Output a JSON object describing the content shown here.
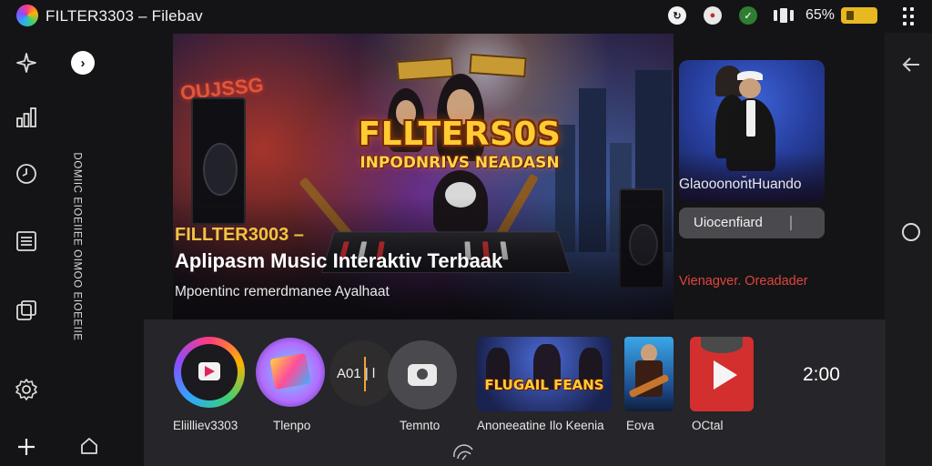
{
  "status_bar": {
    "app_title": "FILTER3303 – Filebav",
    "battery_percent_text": "65%",
    "icons": [
      "app-logo-icon",
      "sync-icon",
      "chrome-icon",
      "shield-icon",
      "vibrate-icon",
      "battery-icon",
      "more-icon"
    ]
  },
  "left_rail": {
    "icons": [
      "sparkle-icon",
      "chart-icon",
      "clock-icon",
      "list-icon",
      "library-icon",
      "settings-icon",
      "add-icon"
    ],
    "expand_glyph": "›",
    "vertical_text": "DOMIIC EIOEIIEE OIMOO EIOEEIIE",
    "home_icon": "home-icon"
  },
  "hero": {
    "art_title": "FLLTERS0S",
    "art_subtitle": "INPODNRIVS NEADASN",
    "graffiti": "OUJSSG",
    "kicker": "FILLTER3003 –",
    "title": "Aplipasm Music Interaktiv  Terbaak",
    "description": "Mpoentinc remerdmanee Ayalhaat"
  },
  "side_panel": {
    "card_caption": "Glaooonon̆tHuando",
    "input_value": "Uiocenfiard",
    "link_text": "Vienagver. Oreadader",
    "accent": "#e0443e"
  },
  "right_rail": {
    "icons": [
      "back-arrow-icon",
      "home-circle-icon"
    ]
  },
  "dock": {
    "items": [
      {
        "label": "Eliilliev3303",
        "icon": "music-app-icon"
      },
      {
        "label": "Tlenpo",
        "icon": "tempo-app-icon"
      },
      {
        "label": "",
        "icon": "audio-meter-icon",
        "text": "A01 | l"
      },
      {
        "label": "Temnto",
        "icon": "camera-app-icon"
      },
      {
        "label": "Anoneeatine Ilo Keenia",
        "icon": "album-art-icon",
        "art_text": "FLUGAIL FEANS"
      },
      {
        "label": "Eova",
        "icon": "guitar-album-icon"
      },
      {
        "label": "OCtal",
        "icon": "red-play-icon"
      }
    ],
    "clock": "2:00",
    "gesture_icon": "gesture-arc-icon"
  },
  "colors": {
    "background": "#141416",
    "dock_background": "#25252a",
    "kicker_yellow": "#f3c343",
    "battery_yellow": "#e7b81f"
  }
}
